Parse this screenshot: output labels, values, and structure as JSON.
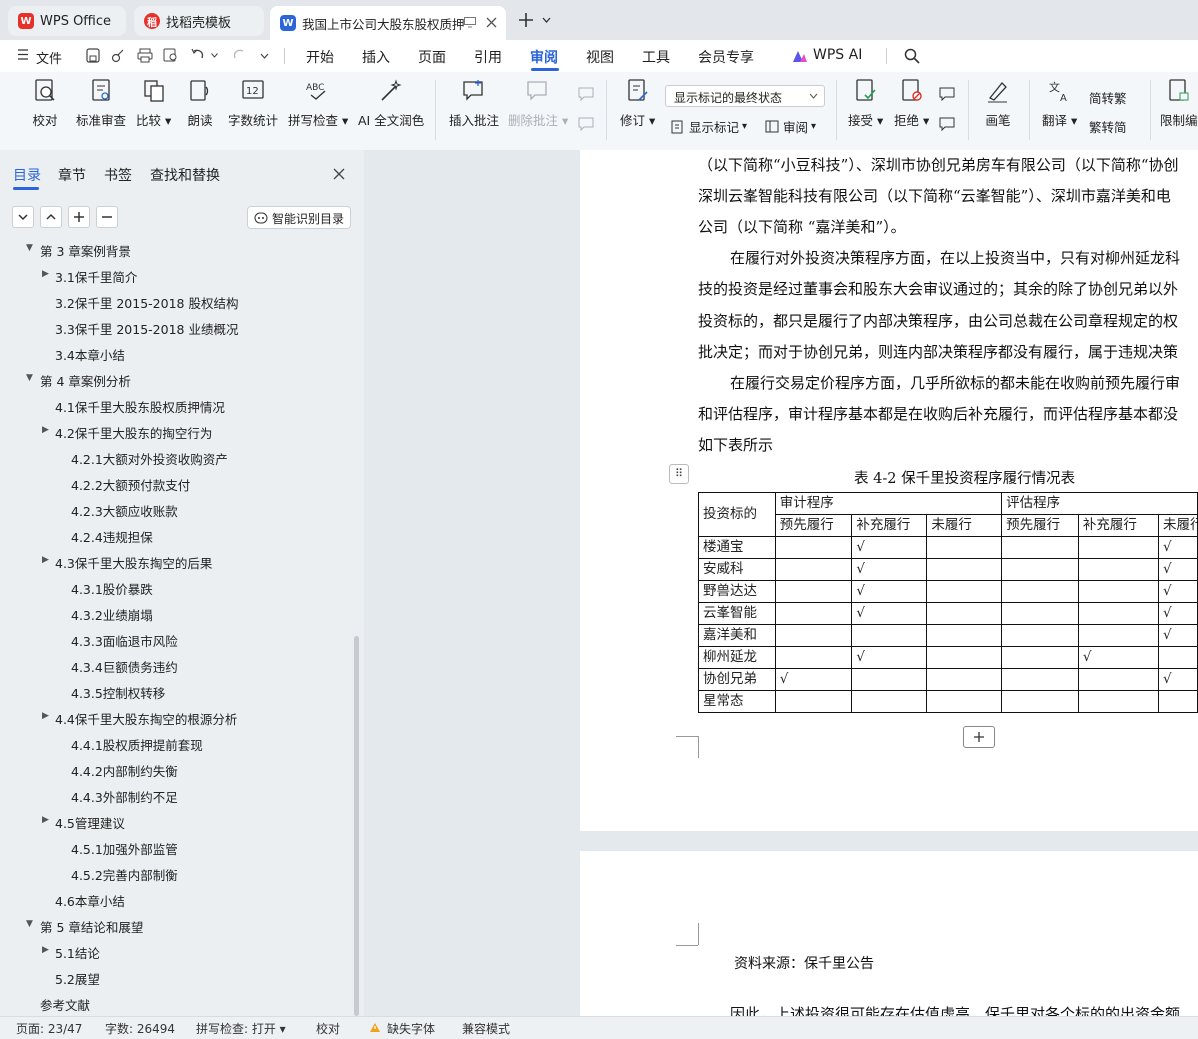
{
  "titlebar": {
    "tabs": [
      {
        "label": "WPS Office",
        "icon": "wps-logo-icon"
      },
      {
        "label": "找稻壳模板",
        "icon": "docer-logo-icon"
      },
      {
        "label": "我国上市公司大股东股权质押",
        "icon": "word-doc-icon"
      }
    ]
  },
  "menubar": {
    "file": "文件",
    "items": [
      "开始",
      "插入",
      "页面",
      "引用",
      "审阅",
      "视图",
      "工具",
      "会员专享",
      "WPS AI"
    ],
    "active": "审阅"
  },
  "ribbon": {
    "proofread": "校对",
    "standard_review": "标准审查",
    "compare": "比较",
    "read_aloud": "朗读",
    "word_count": "字数统计",
    "spell_check": "拼写检查",
    "ai_polish": "AI 全文润色",
    "insert_comment": "插入批注",
    "delete_comment": "删除批注",
    "track_changes": "修订",
    "markup_select": "显示标记的最终状态",
    "show_markup": "显示标记",
    "review": "审阅",
    "accept": "接受",
    "reject": "拒绝",
    "pen": "画笔",
    "translate": "翻译",
    "to_traditional": "简转繁",
    "to_simplified": "繁转简",
    "restrict_edit": "限制编"
  },
  "nav": {
    "tabs": [
      "目录",
      "章节",
      "书签",
      "查找和替换"
    ],
    "active_tab": "目录",
    "smart_toc": "智能识别目录",
    "items": [
      {
        "label": "第 3 章案例背景",
        "level": 1,
        "arrow": "down"
      },
      {
        "label": "3.1保千里简介",
        "level": 2,
        "arrow": "right"
      },
      {
        "label": "3.2保千里 2015-2018 股权结构",
        "level": 2,
        "arrow": ""
      },
      {
        "label": "3.3保千里 2015-2018 业绩概况",
        "level": 2,
        "arrow": ""
      },
      {
        "label": "3.4本章小结",
        "level": 2,
        "arrow": ""
      },
      {
        "label": "第 4 章案例分析",
        "level": 1,
        "arrow": "down"
      },
      {
        "label": "4.1保千里大股东股权质押情况",
        "level": 2,
        "arrow": ""
      },
      {
        "label": "4.2保千里大股东的掏空行为",
        "level": 2,
        "arrow": "right"
      },
      {
        "label": "4.2.1大额对外投资收购资产",
        "level": 3,
        "arrow": ""
      },
      {
        "label": "4.2.2大额预付款支付",
        "level": 3,
        "arrow": ""
      },
      {
        "label": "4.2.3大额应收账款",
        "level": 3,
        "arrow": ""
      },
      {
        "label": "4.2.4违规担保",
        "level": 3,
        "arrow": ""
      },
      {
        "label": "4.3保千里大股东掏空的后果",
        "level": 2,
        "arrow": "right"
      },
      {
        "label": "4.3.1股价暴跌",
        "level": 3,
        "arrow": ""
      },
      {
        "label": "4.3.2业绩崩塌",
        "level": 3,
        "arrow": ""
      },
      {
        "label": "4.3.3面临退市风险",
        "level": 3,
        "arrow": ""
      },
      {
        "label": "4.3.4巨额债务违约",
        "level": 3,
        "arrow": ""
      },
      {
        "label": "4.3.5控制权转移",
        "level": 3,
        "arrow": ""
      },
      {
        "label": "4.4保千里大股东掏空的根源分析",
        "level": 2,
        "arrow": "right"
      },
      {
        "label": "4.4.1股权质押提前套现",
        "level": 3,
        "arrow": ""
      },
      {
        "label": "4.4.2内部制约失衡",
        "level": 3,
        "arrow": ""
      },
      {
        "label": "4.4.3外部制约不足",
        "level": 3,
        "arrow": ""
      },
      {
        "label": "4.5管理建议",
        "level": 2,
        "arrow": "right"
      },
      {
        "label": "4.5.1加强外部监管",
        "level": 3,
        "arrow": ""
      },
      {
        "label": "4.5.2完善内部制衡",
        "level": 3,
        "arrow": ""
      },
      {
        "label": "4.6本章小结",
        "level": 2,
        "arrow": ""
      },
      {
        "label": "第 5 章结论和展望",
        "level": 1,
        "arrow": "down"
      },
      {
        "label": "5.1结论",
        "level": 2,
        "arrow": "right"
      },
      {
        "label": "5.2展望",
        "level": 2,
        "arrow": ""
      },
      {
        "label": "参考文献",
        "level": 1,
        "arrow": ""
      }
    ]
  },
  "document": {
    "lines": [
      "（以下简称“小豆科技”）、深圳市协创兄弟房车有限公司（以下简称“协创",
      "深圳云峯智能科技有限公司（以下简称“云峯智能”）、深圳市嘉洋美和电",
      "公司（以下简称 “嘉洋美和”）。",
      "在履行对外投资决策程序方面，在以上投资当中，只有对柳州延龙科",
      "技的投资是经过董事会和股东大会审议通过的；其余的除了协创兄弟以外",
      "投资标的，都只是履行了内部决策程序，由公司总裁在公司章程规定的权",
      "批决定；而对于协创兄弟，则连内部决策程序都没有履行，属于违规决策",
      "在履行交易定价程序方面，几乎所欲标的都未能在收购前预先履行审",
      "和评估程序，审计程序基本都是在收购后补充履行，而评估程序基本都没",
      "如下表所示"
    ],
    "table_caption": "表 4-2  保千里投资程序履行情况表",
    "table": {
      "col0": "投资标的",
      "group1": "审计程序",
      "group2": "评估程序",
      "sub": [
        "预先履行",
        "补充履行",
        "未履行",
        "预先履行",
        "补充履行",
        "未履行"
      ],
      "check": "√",
      "rows": [
        {
          "name": "楼通宝",
          "marks": [
            0,
            1,
            0,
            0,
            0,
            1
          ]
        },
        {
          "name": "安威科",
          "marks": [
            0,
            1,
            0,
            0,
            0,
            1
          ]
        },
        {
          "name": "野兽达达",
          "marks": [
            0,
            1,
            0,
            0,
            0,
            1
          ]
        },
        {
          "name": "云峯智能",
          "marks": [
            0,
            1,
            0,
            0,
            0,
            1
          ]
        },
        {
          "name": "嘉洋美和",
          "marks": [
            0,
            0,
            0,
            0,
            0,
            1
          ]
        },
        {
          "name": "柳州延龙",
          "marks": [
            0,
            1,
            0,
            0,
            1,
            0
          ]
        },
        {
          "name": "协创兄弟",
          "marks": [
            1,
            0,
            0,
            0,
            0,
            1
          ]
        },
        {
          "name": "星常态",
          "marks": [
            0,
            0,
            0,
            0,
            0,
            0
          ]
        }
      ]
    },
    "source_note": "资料来源：保千里公告",
    "next_line": "因此，上述投资很可能存在估值虚高，保千里对各个标的的出资金额"
  },
  "status": {
    "page": "页面: 23/47",
    "words": "字数: 26494",
    "spell": "拼写检查: 打开",
    "proof": "校对",
    "missing_font": "缺失字体",
    "compat": "兼容模式"
  },
  "colors": {
    "accent": "#2a66d9",
    "wps_red": "#e8302a"
  }
}
